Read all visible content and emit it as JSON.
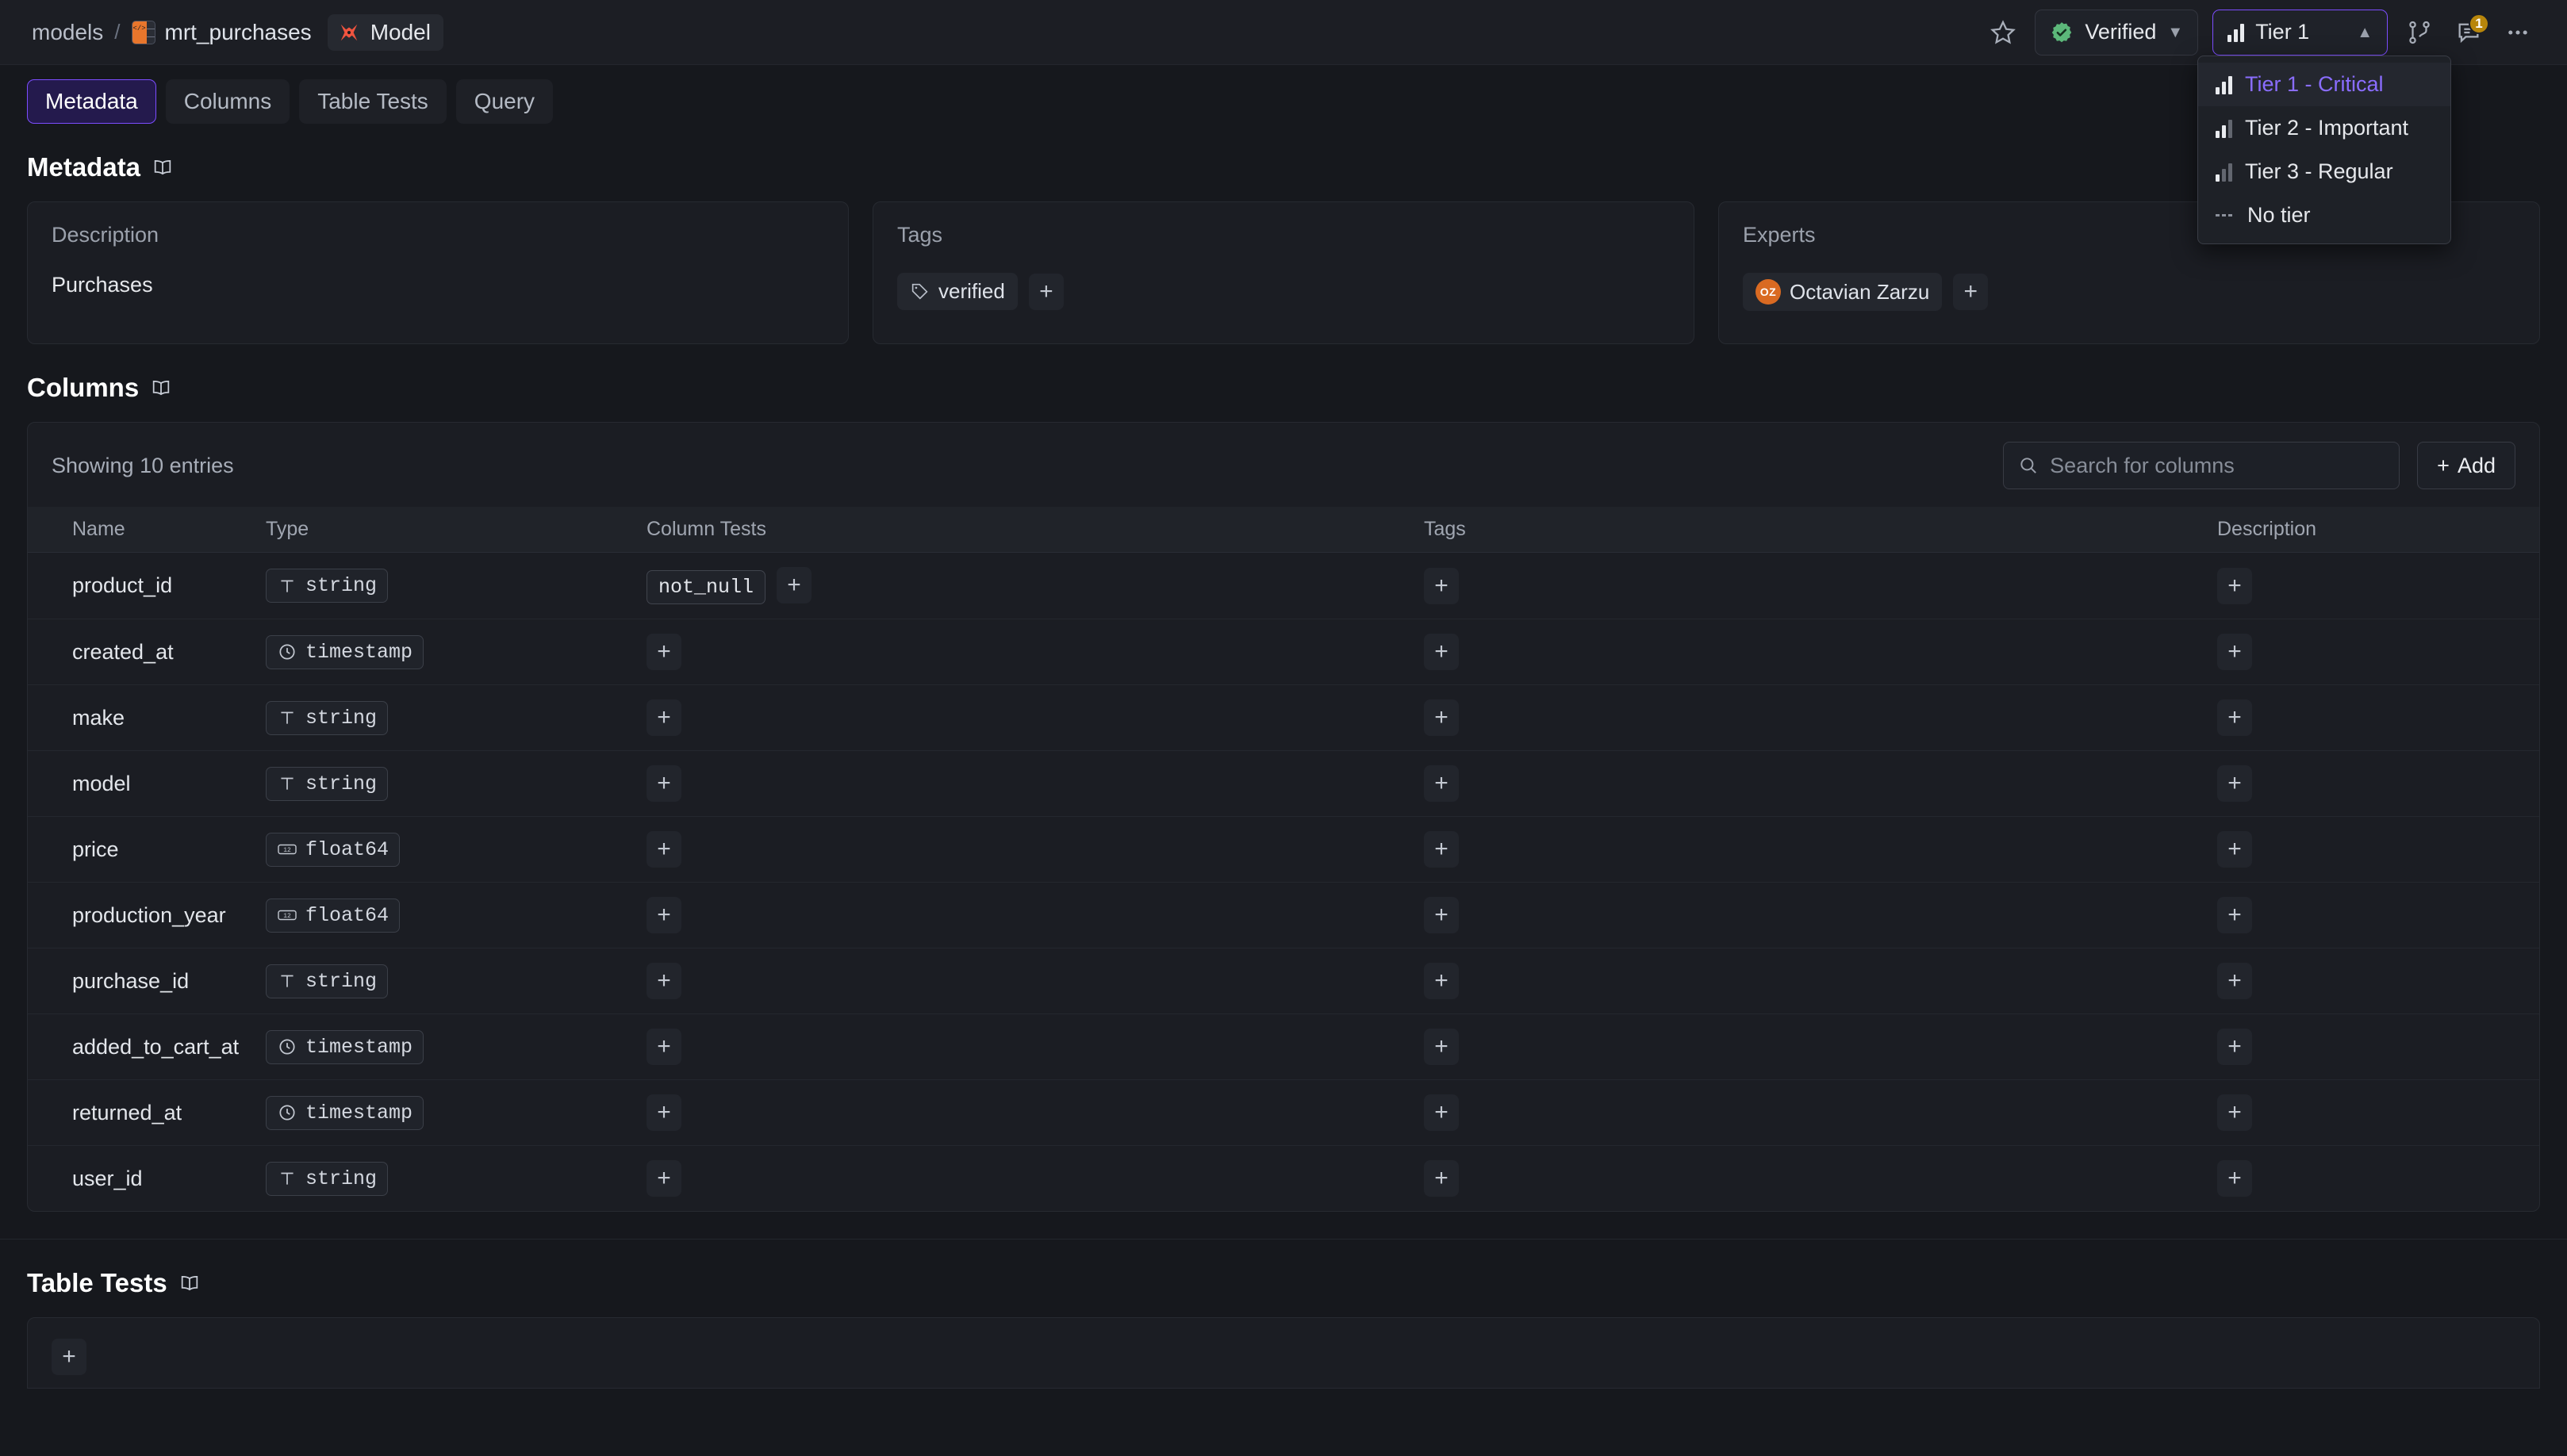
{
  "breadcrumb": {
    "root": "models",
    "separator": "/",
    "table": "mrt_purchases",
    "entity_badge": "Model",
    "table_icon": "dbt-model-table-icon",
    "entity_icon": "dbt-logo-icon"
  },
  "topbar": {
    "star_icon": "star-icon",
    "verified": {
      "label": "Verified",
      "icon": "verified-seal-icon",
      "chevron": "chevron-down-icon"
    },
    "tier": {
      "label": "Tier 1",
      "icon": "tier-bars-icon",
      "chevron": "chevron-up-icon",
      "accent": "#7c4dff"
    },
    "lineage_icon": "git-branch-icon",
    "comments_icon": "comment-icon",
    "comments_count": "1",
    "more_icon": "ellipsis-icon"
  },
  "tier_menu": {
    "items": [
      {
        "label": "Tier 1 - Critical",
        "icon": "tier-bars-1-icon",
        "selected": true
      },
      {
        "label": "Tier 2 - Important",
        "icon": "tier-bars-2-icon",
        "selected": false
      },
      {
        "label": "Tier 3 - Regular",
        "icon": "tier-bars-3-icon",
        "selected": false
      },
      {
        "label": "No tier",
        "icon": "no-tier-dashes-icon",
        "selected": false
      }
    ]
  },
  "tabs": [
    {
      "label": "Metadata",
      "active": true
    },
    {
      "label": "Columns",
      "active": false
    },
    {
      "label": "Table Tests",
      "active": false
    },
    {
      "label": "Query",
      "active": false
    }
  ],
  "metadata": {
    "heading": "Metadata",
    "description": {
      "label": "Description",
      "value": "Purchases"
    },
    "tags": {
      "label": "Tags",
      "items": [
        {
          "label": "verified",
          "icon": "tag-icon"
        }
      ],
      "add": "+"
    },
    "experts": {
      "label": "Experts",
      "items": [
        {
          "name": "Octavian Zarzu",
          "initials": "OZ",
          "avatar_color": "#d96a22"
        }
      ],
      "add": "+"
    }
  },
  "columns_section": {
    "heading": "Columns",
    "entries_text": "Showing 10 entries",
    "search_placeholder": "Search for columns",
    "search_value": "",
    "add_label": "Add",
    "headers": [
      "Name",
      "Type",
      "Column Tests",
      "Tags",
      "Description"
    ],
    "rows": [
      {
        "name": "product_id",
        "type": "string",
        "type_icon": "text-type-icon",
        "tests": [
          "not_null"
        ],
        "tags": [],
        "description": ""
      },
      {
        "name": "created_at",
        "type": "timestamp",
        "type_icon": "clock-type-icon",
        "tests": [],
        "tags": [],
        "description": ""
      },
      {
        "name": "make",
        "type": "string",
        "type_icon": "text-type-icon",
        "tests": [],
        "tags": [],
        "description": ""
      },
      {
        "name": "model",
        "type": "string",
        "type_icon": "text-type-icon",
        "tests": [],
        "tags": [],
        "description": ""
      },
      {
        "name": "price",
        "type": "float64",
        "type_icon": "number-type-icon",
        "tests": [],
        "tags": [],
        "description": ""
      },
      {
        "name": "production_year",
        "type": "float64",
        "type_icon": "number-type-icon",
        "tests": [],
        "tags": [],
        "description": ""
      },
      {
        "name": "purchase_id",
        "type": "string",
        "type_icon": "text-type-icon",
        "tests": [],
        "tags": [],
        "description": ""
      },
      {
        "name": "added_to_cart_at",
        "type": "timestamp",
        "type_icon": "clock-type-icon",
        "tests": [],
        "tags": [],
        "description": ""
      },
      {
        "name": "returned_at",
        "type": "timestamp",
        "type_icon": "clock-type-icon",
        "tests": [],
        "tags": [],
        "description": ""
      },
      {
        "name": "user_id",
        "type": "string",
        "type_icon": "text-type-icon",
        "tests": [],
        "tags": [],
        "description": ""
      }
    ]
  },
  "table_tests_section": {
    "heading": "Table Tests",
    "add": "+"
  }
}
